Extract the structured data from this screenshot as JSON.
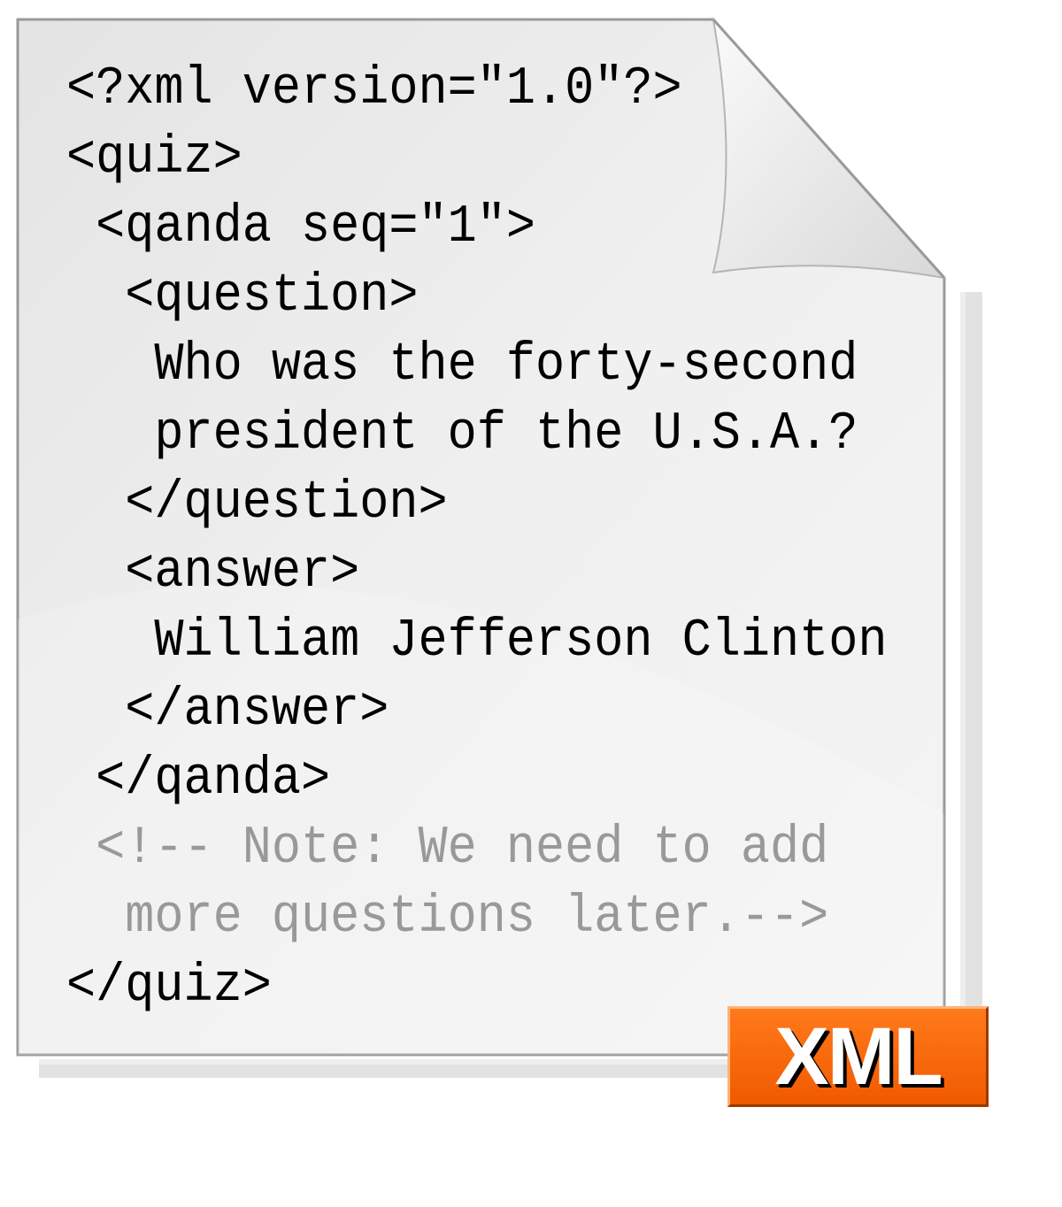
{
  "document": {
    "lines": [
      {
        "text": "<?xml version=\"1.0\"?>",
        "kind": "code"
      },
      {
        "text": "<quiz>",
        "kind": "code"
      },
      {
        "text": " <qanda seq=\"1\">",
        "kind": "code"
      },
      {
        "text": "  <question>",
        "kind": "code"
      },
      {
        "text": "   Who was the forty-second",
        "kind": "code"
      },
      {
        "text": "   president of the U.S.A.?",
        "kind": "code"
      },
      {
        "text": "  </question>",
        "kind": "code"
      },
      {
        "text": "  <answer>",
        "kind": "code"
      },
      {
        "text": "   William Jefferson Clinton",
        "kind": "code"
      },
      {
        "text": "  </answer>",
        "kind": "code"
      },
      {
        "text": " </qanda>",
        "kind": "code"
      },
      {
        "text": " <!-- Note: We need to add",
        "kind": "comment"
      },
      {
        "text": "  more questions later.-->",
        "kind": "comment"
      },
      {
        "text": "</quiz>",
        "kind": "code"
      }
    ]
  },
  "badge": {
    "label": "XML"
  },
  "colors": {
    "code_text": "#000000",
    "comment_text": "#999999",
    "badge_background": "#f26a0a",
    "page_background": "#efefef",
    "page_border": "#999999"
  },
  "icon": "xml-file-icon"
}
